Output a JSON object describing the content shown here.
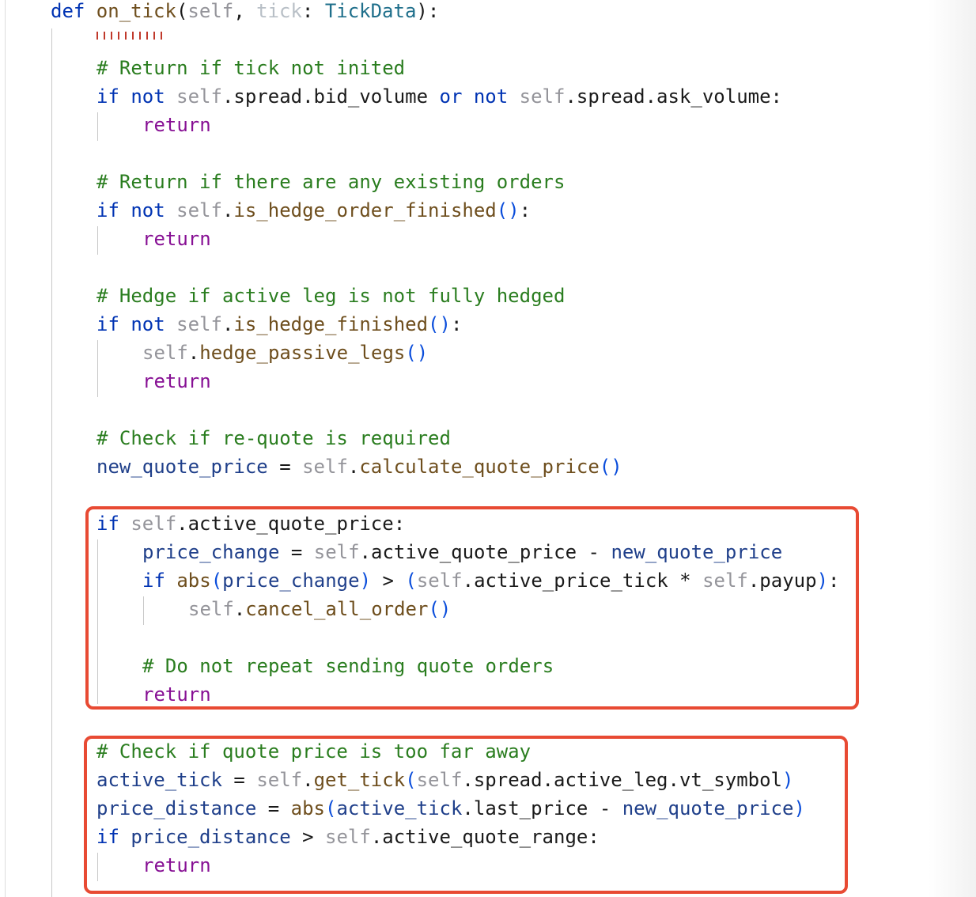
{
  "editor": {
    "language": "python",
    "highlight_color": "#e84a33",
    "highlight_boxes": [
      {
        "from_line": 18,
        "to_line": 24
      },
      {
        "from_line": 26,
        "to_line": 30
      }
    ],
    "lines": [
      [
        [
          "kw",
          "def "
        ],
        [
          "fn",
          "on_tick"
        ],
        [
          "",
          "("
        ],
        [
          "sf",
          "self"
        ],
        [
          "",
          ", "
        ],
        [
          "hint",
          "tick"
        ],
        [
          "",
          ": "
        ],
        [
          "ty",
          "TickData"
        ],
        [
          "",
          "):"
        ]
      ],
      [],
      [
        [
          "cm",
          "# Return if tick not inited"
        ]
      ],
      [
        [
          "kw",
          "if not "
        ],
        [
          "sf",
          "self"
        ],
        [
          "",
          ".spread.bid_volume "
        ],
        [
          "kw",
          "or not "
        ],
        [
          "sf",
          "self"
        ],
        [
          "",
          ".spread.ask_volume:"
        ]
      ],
      [
        [
          "ret",
          "return"
        ]
      ],
      [],
      [
        [
          "cm",
          "# Return if there are any existing orders"
        ]
      ],
      [
        [
          "kw",
          "if not "
        ],
        [
          "sf",
          "self"
        ],
        [
          "",
          "."
        ],
        [
          "fn",
          "is_hedge_order_finished"
        ],
        [
          "par",
          "()"
        ],
        [
          "",
          ":"
        ]
      ],
      [
        [
          "ret",
          "return"
        ]
      ],
      [],
      [
        [
          "cm",
          "# Hedge if active leg is not fully hedged"
        ]
      ],
      [
        [
          "kw",
          "if not "
        ],
        [
          "sf",
          "self"
        ],
        [
          "",
          "."
        ],
        [
          "fn",
          "is_hedge_finished"
        ],
        [
          "par",
          "()"
        ],
        [
          "",
          ":"
        ]
      ],
      [
        [
          "sf",
          "self"
        ],
        [
          "",
          "."
        ],
        [
          "fn",
          "hedge_passive_legs"
        ],
        [
          "par",
          "()"
        ]
      ],
      [
        [
          "ret",
          "return"
        ]
      ],
      [],
      [
        [
          "cm",
          "# Check if re-quote is required"
        ]
      ],
      [
        [
          "var",
          "new_quote_price"
        ],
        [
          "",
          " = "
        ],
        [
          "sf",
          "self"
        ],
        [
          "",
          "."
        ],
        [
          "fn",
          "calculate_quote_price"
        ],
        [
          "par",
          "()"
        ]
      ],
      [],
      [
        [
          "kw",
          "if "
        ],
        [
          "sf",
          "self"
        ],
        [
          "",
          ".active_quote_price:"
        ]
      ],
      [
        [
          "var",
          "price_change"
        ],
        [
          "",
          " = "
        ],
        [
          "sf",
          "self"
        ],
        [
          "",
          ".active_quote_price - "
        ],
        [
          "var",
          "new_quote_price"
        ]
      ],
      [
        [
          "kw",
          "if "
        ],
        [
          "bi",
          "abs"
        ],
        [
          "par",
          "("
        ],
        [
          "var",
          "price_change"
        ],
        [
          "par",
          ")"
        ],
        [
          "",
          " > "
        ],
        [
          "par",
          "("
        ],
        [
          "sf",
          "self"
        ],
        [
          "",
          ".active_price_tick * "
        ],
        [
          "sf",
          "self"
        ],
        [
          "",
          ".payup"
        ],
        [
          "par",
          ")"
        ],
        [
          "",
          ":"
        ]
      ],
      [
        [
          "sf",
          "self"
        ],
        [
          "",
          "."
        ],
        [
          "fn",
          "cancel_all_order"
        ],
        [
          "par",
          "()"
        ]
      ],
      [],
      [
        [
          "cm",
          "# Do not repeat sending quote orders"
        ]
      ],
      [
        [
          "ret",
          "return"
        ]
      ],
      [],
      [
        [
          "cm",
          "# Check if quote price is too far away"
        ]
      ],
      [
        [
          "var",
          "active_tick"
        ],
        [
          "",
          " = "
        ],
        [
          "sf",
          "self"
        ],
        [
          "",
          "."
        ],
        [
          "fn",
          "get_tick"
        ],
        [
          "par",
          "("
        ],
        [
          "sf",
          "self"
        ],
        [
          "",
          ".spread.active_leg.vt_symbol"
        ],
        [
          "par",
          ")"
        ]
      ],
      [
        [
          "var",
          "price_distance"
        ],
        [
          "",
          " = "
        ],
        [
          "bi",
          "abs"
        ],
        [
          "par",
          "("
        ],
        [
          "var",
          "active_tick"
        ],
        [
          "",
          ".last_price - "
        ],
        [
          "var",
          "new_quote_price"
        ],
        [
          "par",
          ")"
        ]
      ],
      [
        [
          "kw",
          "if "
        ],
        [
          "var",
          "price_distance"
        ],
        [
          "",
          " > "
        ],
        [
          "sf",
          "self"
        ],
        [
          "",
          ".active_quote_range:"
        ]
      ],
      [
        [
          "ret",
          "return"
        ]
      ]
    ]
  }
}
